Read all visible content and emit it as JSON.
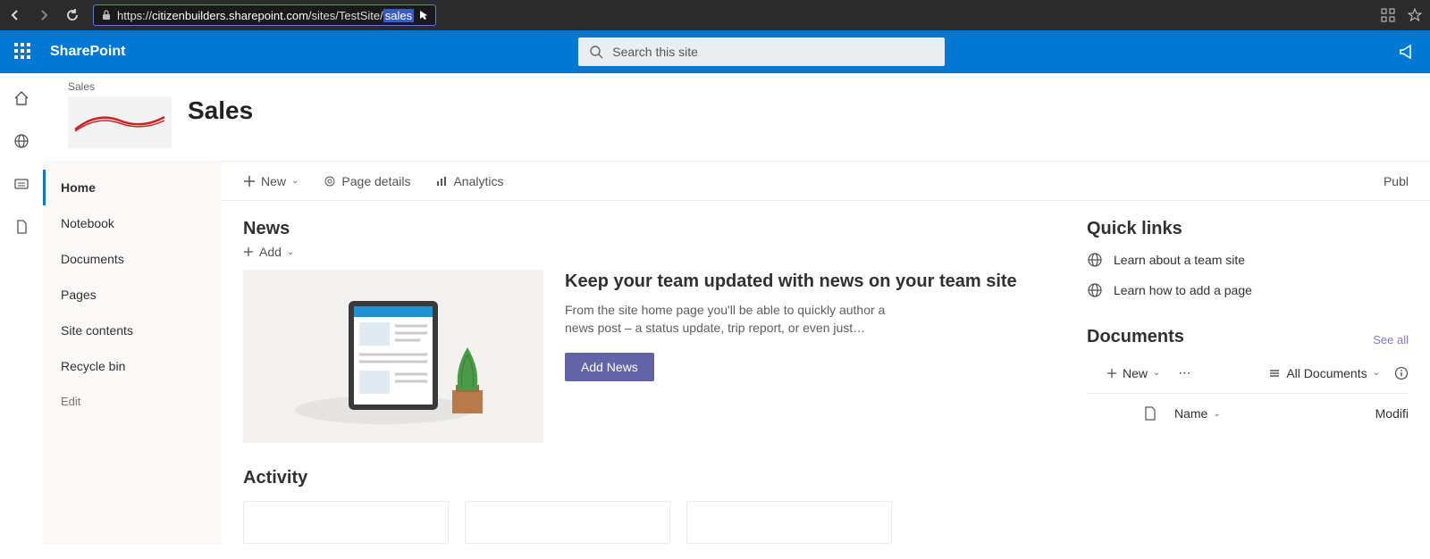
{
  "browser": {
    "url_prefix": "https://",
    "url_host": "citizenbuilders.sharepoint.com",
    "url_path": "/sites/TestSite/",
    "url_sel": "sales"
  },
  "header": {
    "product": "SharePoint",
    "search_placeholder": "Search this site"
  },
  "site": {
    "breadcrumb": "Sales",
    "title": "Sales"
  },
  "nav": {
    "items": [
      "Home",
      "Notebook",
      "Documents",
      "Pages",
      "Site contents",
      "Recycle bin"
    ],
    "edit": "Edit"
  },
  "cmdbar": {
    "new": "New",
    "page_details": "Page details",
    "analytics": "Analytics",
    "publish": "Publ"
  },
  "news": {
    "title": "News",
    "add": "Add",
    "hero_title": "Keep your team updated with news on your team site",
    "hero_body": "From the site home page you'll be able to quickly author a news post – a status update, trip report, or even just…",
    "button": "Add News"
  },
  "activity": {
    "title": "Activity"
  },
  "quicklinks": {
    "title": "Quick links",
    "items": [
      "Learn about a team site",
      "Learn how to add a page"
    ]
  },
  "documents": {
    "title": "Documents",
    "see_all": "See all",
    "new": "New",
    "view": "All Documents",
    "col_name": "Name",
    "col_mod": "Modifi"
  }
}
